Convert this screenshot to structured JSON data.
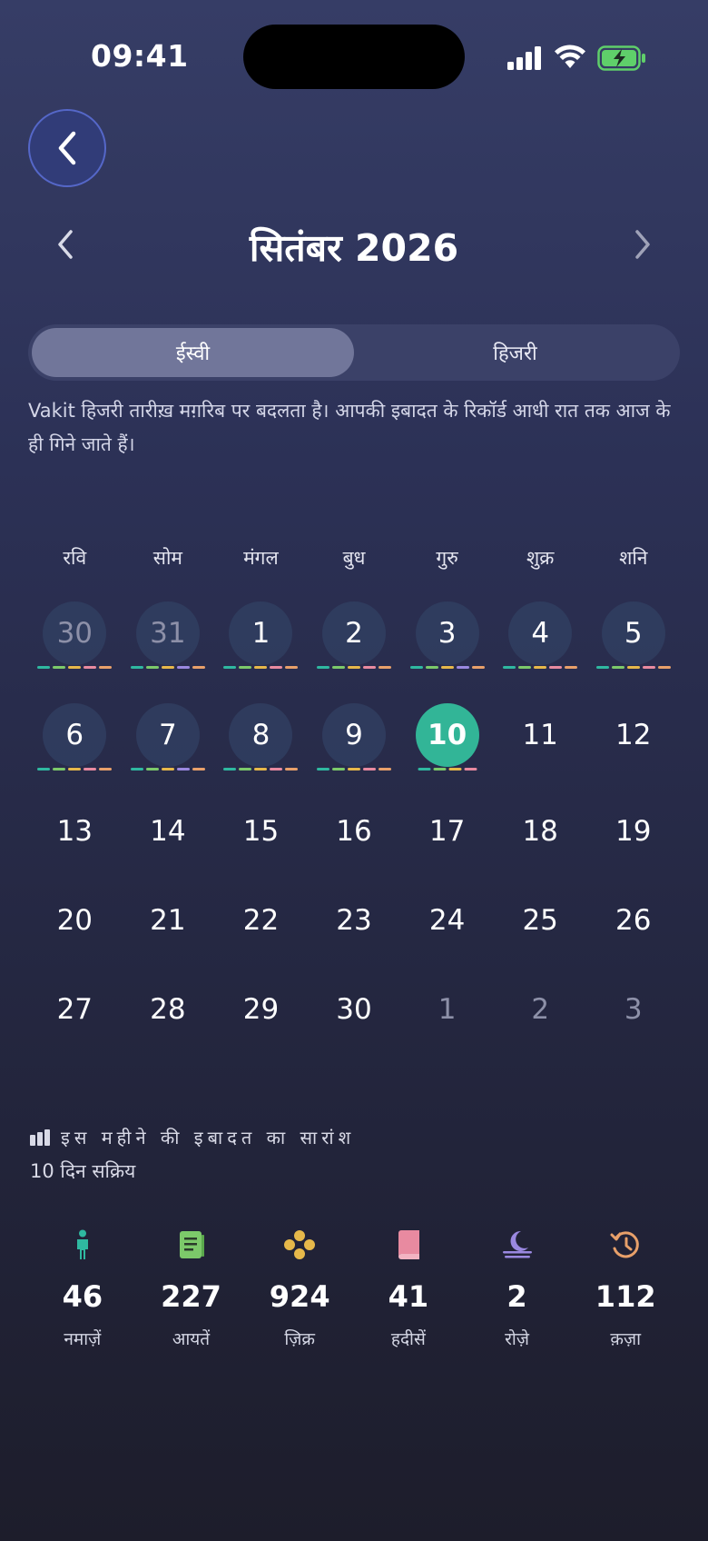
{
  "status": {
    "time": "09:41"
  },
  "header": {
    "month_title": "सितंबर 2026"
  },
  "segment": {
    "options": [
      {
        "label": "ईस्वी",
        "active": true
      },
      {
        "label": "हिजरी",
        "active": false
      }
    ]
  },
  "note": "Vakit हिजरी तारीख़ मग़रिब पर बदलता है। आपकी इबादत के रिकॉर्ड आधी रात तक आज के ही गिने जाते हैं।",
  "calendar": {
    "weekdays": [
      "रवि",
      "सोम",
      "मंगल",
      "बुध",
      "गुरु",
      "शुक्र",
      "शनि"
    ],
    "weeks": [
      [
        {
          "day": "30",
          "outside": true,
          "recorded": true,
          "bars": [
            "#2fb8a0",
            "#7cc96a",
            "#e6b84a",
            "#e88aa0",
            "#e8a06a"
          ]
        },
        {
          "day": "31",
          "outside": true,
          "recorded": true,
          "bars": [
            "#2fb8a0",
            "#7cc96a",
            "#e6b84a",
            "#9a88e0",
            "#e8a06a"
          ]
        },
        {
          "day": "1",
          "recorded": true,
          "bars": [
            "#2fb8a0",
            "#7cc96a",
            "#e6b84a",
            "#e88aa0",
            "#e8a06a"
          ]
        },
        {
          "day": "2",
          "recorded": true,
          "bars": [
            "#2fb8a0",
            "#7cc96a",
            "#e6b84a",
            "#e88aa0",
            "#e8a06a"
          ]
        },
        {
          "day": "3",
          "recorded": true,
          "bars": [
            "#2fb8a0",
            "#7cc96a",
            "#e6b84a",
            "#9a88e0",
            "#e8a06a"
          ]
        },
        {
          "day": "4",
          "recorded": true,
          "bars": [
            "#2fb8a0",
            "#7cc96a",
            "#e6b84a",
            "#e88aa0",
            "#e8a06a"
          ]
        },
        {
          "day": "5",
          "recorded": true,
          "bars": [
            "#2fb8a0",
            "#7cc96a",
            "#e6b84a",
            "#e88aa0",
            "#e8a06a"
          ]
        }
      ],
      [
        {
          "day": "6",
          "recorded": true,
          "bars": [
            "#2fb8a0",
            "#7cc96a",
            "#e6b84a",
            "#e88aa0",
            "#e8a06a"
          ]
        },
        {
          "day": "7",
          "recorded": true,
          "bars": [
            "#2fb8a0",
            "#7cc96a",
            "#e6b84a",
            "#9a88e0",
            "#e8a06a"
          ]
        },
        {
          "day": "8",
          "recorded": true,
          "bars": [
            "#2fb8a0",
            "#7cc96a",
            "#e6b84a",
            "#e88aa0",
            "#e8a06a"
          ]
        },
        {
          "day": "9",
          "recorded": true,
          "bars": [
            "#2fb8a0",
            "#7cc96a",
            "#e6b84a",
            "#e88aa0",
            "#e8a06a"
          ]
        },
        {
          "day": "10",
          "today": true,
          "recorded": true,
          "bars": [
            "#2fb8a0",
            "#7cc96a",
            "#e6b84a",
            "#e88aa0"
          ]
        },
        {
          "day": "11"
        },
        {
          "day": "12"
        }
      ],
      [
        {
          "day": "13"
        },
        {
          "day": "14"
        },
        {
          "day": "15"
        },
        {
          "day": "16"
        },
        {
          "day": "17"
        },
        {
          "day": "18"
        },
        {
          "day": "19"
        }
      ],
      [
        {
          "day": "20"
        },
        {
          "day": "21"
        },
        {
          "day": "22"
        },
        {
          "day": "23"
        },
        {
          "day": "24"
        },
        {
          "day": "25"
        },
        {
          "day": "26"
        }
      ],
      [
        {
          "day": "27"
        },
        {
          "day": "28"
        },
        {
          "day": "29"
        },
        {
          "day": "30"
        },
        {
          "day": "1",
          "outside": true
        },
        {
          "day": "2",
          "outside": true
        },
        {
          "day": "3",
          "outside": true
        }
      ]
    ]
  },
  "summary": {
    "title": "इस महीने की इबादत का सारांश",
    "active_days": "10 दिन सक्रिय",
    "stats": [
      {
        "icon": "person-icon",
        "value": "46",
        "label": "नमाज़ें",
        "color": "#2fb8a0"
      },
      {
        "icon": "book-open-icon",
        "value": "227",
        "label": "आयतें",
        "color": "#7cc96a"
      },
      {
        "icon": "beads-icon",
        "value": "924",
        "label": "ज़िक्र",
        "color": "#e6b84a"
      },
      {
        "icon": "book-icon",
        "value": "41",
        "label": "हदीसें",
        "color": "#e88aa0"
      },
      {
        "icon": "moon-icon",
        "value": "2",
        "label": "रोज़े",
        "color": "#9a88e0"
      },
      {
        "icon": "history-icon",
        "value": "112",
        "label": "क़ज़ा",
        "color": "#e8a06a"
      }
    ]
  }
}
